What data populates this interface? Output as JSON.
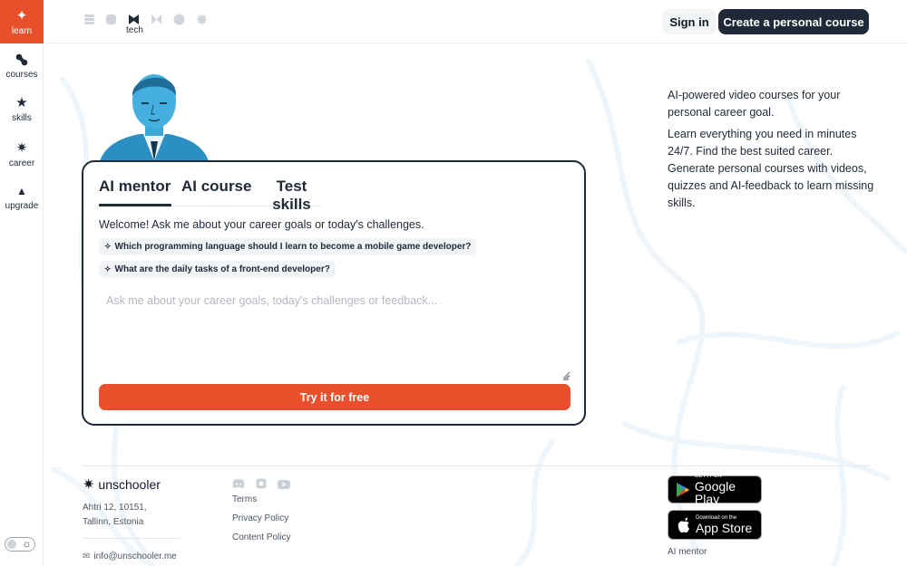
{
  "rail": {
    "items": [
      {
        "label": "learn",
        "icon": "sparkle-icon",
        "glyph": "✦",
        "active": true
      },
      {
        "label": "courses",
        "icon": "courses-icon",
        "glyph": "❧",
        "active": false
      },
      {
        "label": "skills",
        "icon": "star-icon",
        "glyph": "★",
        "active": false
      },
      {
        "label": "career",
        "icon": "burst-icon",
        "glyph": "✷",
        "active": false
      },
      {
        "label": "upgrade",
        "icon": "triangle-icon",
        "glyph": "▲",
        "active": false
      }
    ]
  },
  "header": {
    "topic_selected_label": "tech",
    "signin_label": "Sign in",
    "create_label": "Create a personal course"
  },
  "card": {
    "tabs": [
      "AI mentor",
      "AI course",
      "Test skills"
    ],
    "welcome": "Welcome! Ask me about your career goals or today's challenges.",
    "suggestions": [
      "Which programming language should I learn to become a mobile game developer?",
      "What are the daily tasks of a front-end developer?"
    ],
    "placeholder": "Ask me about your career goals, today's challenges or feedback...",
    "cta_label": "Try it for free"
  },
  "description": {
    "p1": "AI-powered video courses for your personal career goal.",
    "p2": "Learn everything you need in minutes 24/7. Find the best suited career. Generate personal courses with videos, quizzes and AI-feedback to learn missing skills."
  },
  "footer": {
    "brand": "unschooler",
    "address_line1": "Ahtri 12, 10151,",
    "address_line2": "Tallinn, Estonia",
    "email": "info@unschooler.me",
    "links": [
      "Terms",
      "Privacy Policy",
      "Content Policy"
    ],
    "google_play_small": "GET IT ON",
    "google_play_big": "Google Play",
    "app_store_small": "Download on the",
    "app_store_big": "App Store",
    "mentor_link": "AI mentor"
  },
  "colors": {
    "accent": "#e8502c",
    "dark": "#1f2937",
    "portrait": "#3fa7d6"
  }
}
